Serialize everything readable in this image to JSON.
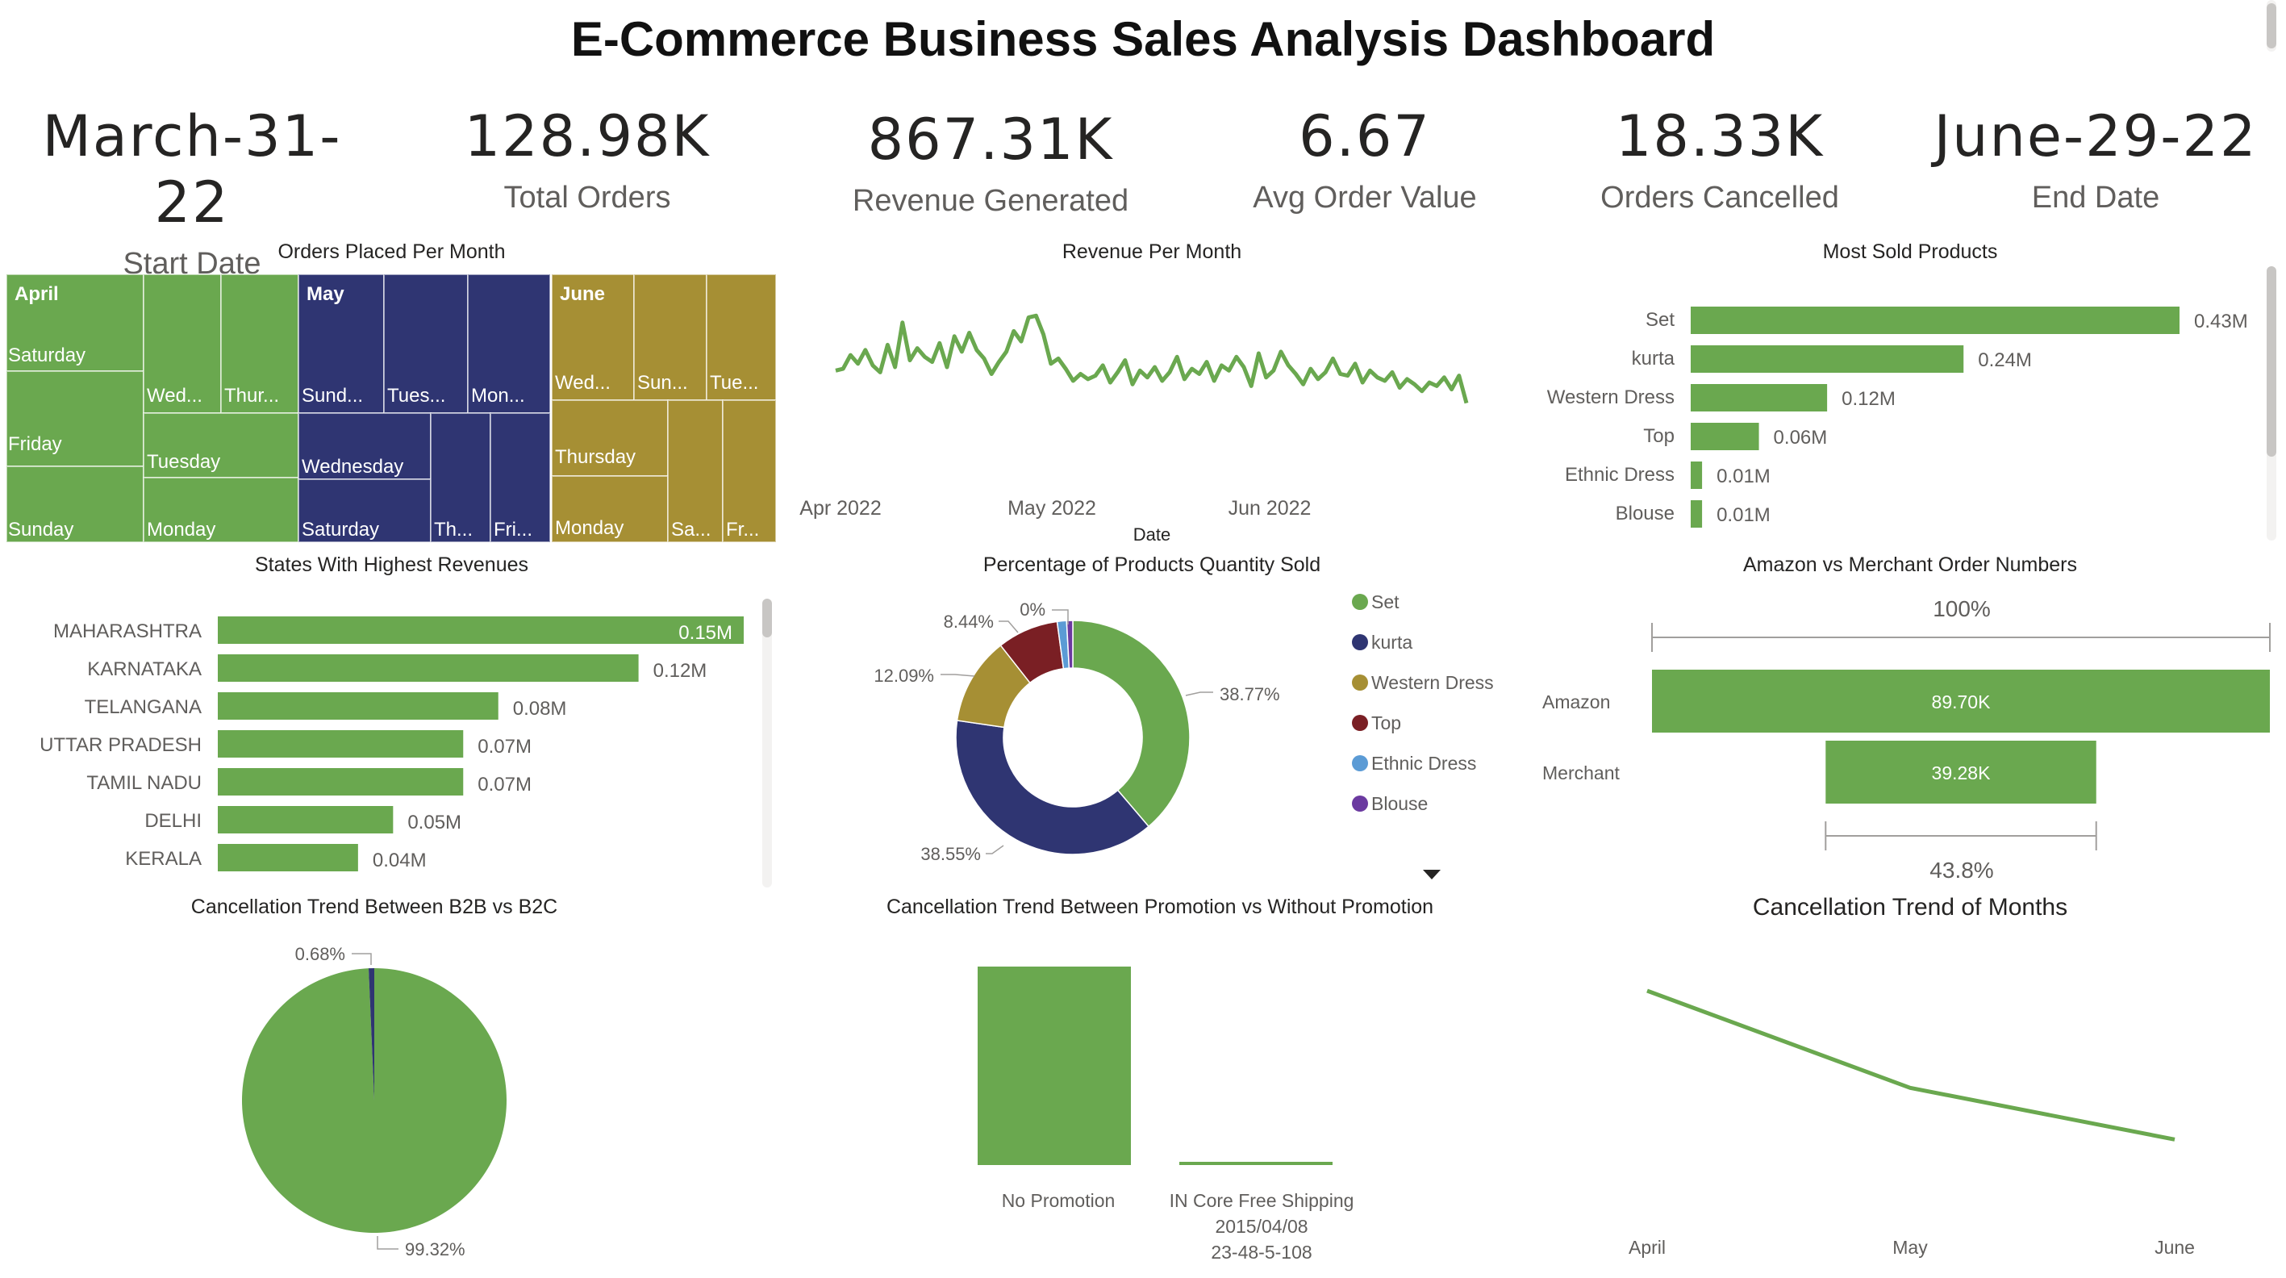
{
  "dashboard": {
    "title": "E-Commerce Business Sales Analysis Dashboard"
  },
  "kpis": [
    {
      "value": "March-31-22",
      "label": "Start Date"
    },
    {
      "value": "128.98K",
      "label": "Total Orders"
    },
    {
      "value": "867.31K",
      "label": "Revenue Generated"
    },
    {
      "value": "6.67",
      "label": "Avg Order Value"
    },
    {
      "value": "18.33K",
      "label": "Orders Cancelled"
    },
    {
      "value": "June-29-22",
      "label": "End Date"
    }
  ],
  "colors": {
    "green": "#6aa84f",
    "navy": "#2f3572",
    "olive": "#a68f34",
    "maroon": "#7a1f24",
    "lightblue": "#5b9bd5",
    "purple": "#6b3aa0"
  },
  "visual_titles": {
    "orders_per_month": "Orders Placed Per Month",
    "revenue_per_month": "Revenue Per Month",
    "most_sold": "Most Sold Products",
    "states": "States With Highest Revenues",
    "pct_products": "Percentage of Products Quantity Sold",
    "amazon_merchant": "Amazon vs Merchant Order Numbers",
    "b2b": "Cancellation Trend Between B2B vs B2C",
    "promotion": "Cancellation Trend Between Promotion vs Without Promotion",
    "months": "Cancellation Trend of Months"
  },
  "chart_data": [
    {
      "id": "orders_per_month",
      "type": "treemap",
      "title": "Orders Placed Per Month",
      "groups": [
        {
          "name": "April",
          "color": "#6aa84f",
          "cells": [
            "Saturday",
            "Friday",
            "Sunday",
            "Wed...",
            "Thur...",
            "Tuesday",
            "Monday"
          ]
        },
        {
          "name": "May",
          "color": "#2f3572",
          "cells": [
            "Sund...",
            "Tues...",
            "Mon...",
            "Wednesday",
            "Saturday",
            "Th...",
            "Fri..."
          ]
        },
        {
          "name": "June",
          "color": "#a68f34",
          "cells": [
            "Wed...",
            "Sun...",
            "Tue...",
            "Thursday",
            "Monday",
            "Sa...",
            "Fr..."
          ]
        }
      ]
    },
    {
      "id": "revenue_per_month",
      "type": "line",
      "title": "Revenue Per Month",
      "xlabel": "Date",
      "x_ticks": [
        "Apr 2022",
        "May 2022",
        "Jun 2022"
      ],
      "x_range": [
        "2022-03-31",
        "2022-06-29"
      ],
      "y": [
        8.8,
        8.9,
        9.7,
        9.2,
        10.0,
        9.1,
        8.7,
        10.3,
        9.0,
        11.6,
        9.4,
        10.1,
        9.6,
        9.3,
        10.4,
        9.0,
        10.8,
        9.9,
        11.0,
        10.0,
        9.5,
        8.6,
        9.3,
        9.9,
        11.1,
        10.5,
        11.9,
        12.0,
        10.9,
        9.2,
        9.5,
        8.9,
        8.2,
        8.6,
        8.3,
        8.5,
        9.1,
        8.1,
        8.7,
        9.4,
        8.0,
        8.8,
        8.4,
        9.0,
        8.2,
        8.7,
        9.6,
        8.3,
        8.9,
        8.6,
        9.3,
        8.2,
        9.1,
        8.8,
        9.6,
        9.0,
        7.9,
        9.8,
        8.4,
        8.8,
        9.9,
        9.1,
        8.6,
        8.0,
        8.9,
        8.3,
        8.7,
        9.5,
        8.6,
        8.5,
        9.2,
        8.1,
        8.8,
        8.4,
        8.2,
        8.7,
        7.8,
        8.3,
        8.0,
        7.6,
        8.1,
        7.9,
        8.4,
        7.7,
        8.5,
        6.9
      ]
    },
    {
      "id": "most_sold",
      "type": "bar",
      "title": "Most Sold Products",
      "categories": [
        "Set",
        "kurta",
        "Western Dress",
        "Top",
        "Ethnic Dress",
        "Blouse"
      ],
      "values": [
        0.43,
        0.24,
        0.12,
        0.06,
        0.01,
        0.01
      ],
      "labels": [
        "0.43M",
        "0.24M",
        "0.12M",
        "0.06M",
        "0.01M",
        "0.01M"
      ]
    },
    {
      "id": "states",
      "type": "bar",
      "title": "States With Highest Revenues",
      "categories": [
        "MAHARASHTRA",
        "KARNATAKA",
        "TELANGANA",
        "UTTAR PRADESH",
        "TAMIL NADU",
        "DELHI",
        "KERALA"
      ],
      "values": [
        0.15,
        0.12,
        0.08,
        0.07,
        0.07,
        0.05,
        0.04
      ],
      "labels": [
        "0.15M",
        "0.12M",
        "0.08M",
        "0.07M",
        "0.07M",
        "0.05M",
        "0.04M"
      ]
    },
    {
      "id": "pct_products",
      "type": "pie",
      "title": "Percentage of Products Quantity Sold",
      "categories": [
        "Set",
        "kurta",
        "Western Dress",
        "Top",
        "Ethnic Dress",
        "Blouse"
      ],
      "values": [
        38.77,
        38.55,
        12.09,
        8.44,
        1.3,
        0.85
      ],
      "labels": [
        "38.77%",
        "38.55%",
        "12.09%",
        "8.44%",
        "",
        "0%"
      ],
      "legend": "right"
    },
    {
      "id": "amazon_merchant",
      "type": "bar",
      "title": "Amazon vs Merchant Order Numbers",
      "categories": [
        "Amazon",
        "Merchant"
      ],
      "values": [
        89.7,
        39.28
      ],
      "labels": [
        "89.70K",
        "39.28K"
      ],
      "top_pct": "100%",
      "bottom_pct": "43.8%"
    },
    {
      "id": "b2b",
      "type": "pie",
      "title": "Cancellation Trend Between B2B vs B2C",
      "values": [
        99.32,
        0.68
      ],
      "labels": [
        "99.32%",
        "0.68%"
      ]
    },
    {
      "id": "promotion",
      "type": "bar",
      "title": "Cancellation Trend Between Promotion vs Without Promotion",
      "categories": [
        "No Promotion",
        "IN Core Free Shipping\n2015/04/08\n23-48-5-108"
      ],
      "values": [
        100,
        1.5
      ]
    },
    {
      "id": "months",
      "type": "line",
      "title": "Cancellation Trend of Months",
      "categories": [
        "April",
        "May",
        "June"
      ],
      "values": [
        100,
        53,
        28
      ]
    }
  ]
}
